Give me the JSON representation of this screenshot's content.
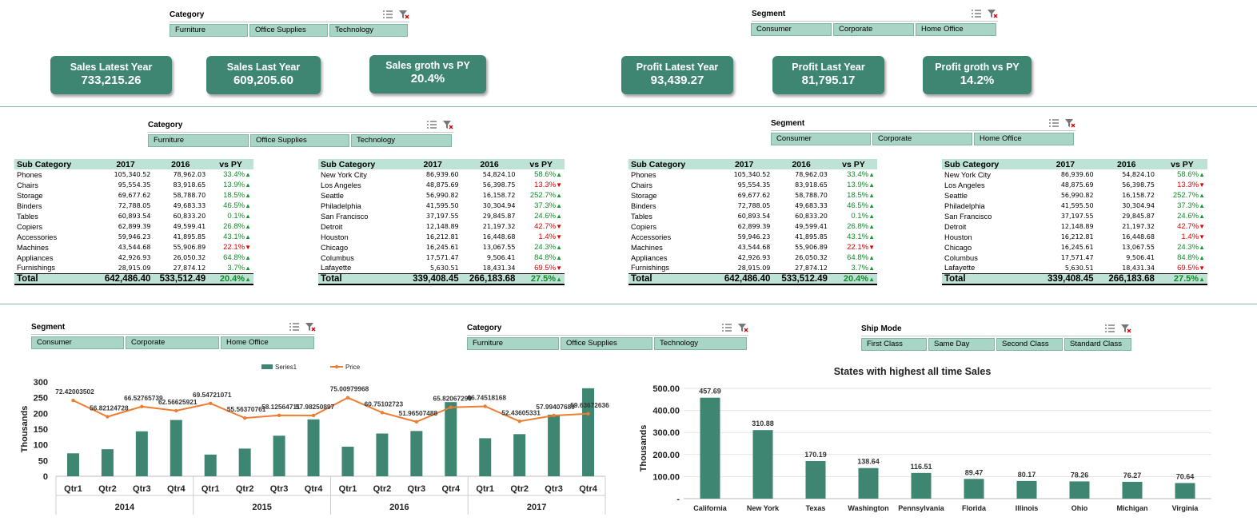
{
  "slicers": {
    "category_top": {
      "title": "Category",
      "items": [
        "Furniture",
        "Office Supplies",
        "Technology"
      ]
    },
    "segment_top": {
      "title": "Segment",
      "items": [
        "Consumer",
        "Corporate",
        "Home Office"
      ]
    },
    "category_mid": {
      "title": "Category",
      "items": [
        "Furniture",
        "Office Supplies",
        "Technology"
      ]
    },
    "segment_mid": {
      "title": "Segment",
      "items": [
        "Consumer",
        "Corporate",
        "Home Office"
      ]
    },
    "segment_bottom": {
      "title": "Segment",
      "items": [
        "Consumer",
        "Corporate",
        "Home Office"
      ]
    },
    "category_bottom": {
      "title": "Category",
      "items": [
        "Furniture",
        "Office Supplies",
        "Technology"
      ]
    },
    "shipmode": {
      "title": "Ship Mode",
      "items": [
        "First Class",
        "Same Day",
        "Second Class",
        "Standard Class"
      ]
    }
  },
  "kpis": [
    {
      "label": "Sales Latest Year",
      "value": "733,215.26"
    },
    {
      "label": "Sales Last Year",
      "value": "609,205.60"
    },
    {
      "label": "Sales groth vs PY",
      "value": "20.4%"
    },
    {
      "label": "Profit Latest Year",
      "value": "93,439.27"
    },
    {
      "label": "Profit Last Year",
      "value": "81,795.17"
    },
    {
      "label": "Profit groth vs PY",
      "value": "14.2%"
    }
  ],
  "colors": {
    "accent": "#3e8671",
    "slicer": "#a9d5c7",
    "header": "#bfe2d6",
    "positive": "#118a2a",
    "negative": "#e00000",
    "line": "#ed7d31"
  },
  "tables": {
    "subcategory": {
      "headers": [
        "Sub Category",
        "2017",
        "2016",
        "vs PY"
      ],
      "rows": [
        [
          "Phones",
          "105,340.52",
          "78,962.03",
          "33.4%",
          "up"
        ],
        [
          "Chairs",
          "95,554.35",
          "83,918.65",
          "13.9%",
          "up"
        ],
        [
          "Storage",
          "69,677.62",
          "58,788.70",
          "18.5%",
          "up"
        ],
        [
          "Binders",
          "72,788.05",
          "49,683.33",
          "46.5%",
          "up"
        ],
        [
          "Tables",
          "60,893.54",
          "60,833.20",
          "0.1%",
          "up"
        ],
        [
          "Copiers",
          "62,899.39",
          "49,599.41",
          "26.8%",
          "up"
        ],
        [
          "Accessories",
          "59,946.23",
          "41,895.85",
          "43.1%",
          "up"
        ],
        [
          "Machines",
          "43,544.68",
          "55,906.89",
          "22.1%",
          "down"
        ],
        [
          "Appliances",
          "42,926.93",
          "26,050.32",
          "64.8%",
          "up"
        ],
        [
          "Furnishings",
          "28,915.09",
          "27,874.12",
          "3.7%",
          "up"
        ]
      ],
      "total": [
        "Total",
        "642,486.40",
        "533,512.49",
        "20.4%",
        "up"
      ]
    },
    "city": {
      "headers": [
        "Sub Category",
        "2017",
        "2016",
        "vs PY"
      ],
      "rows": [
        [
          "New York City",
          "86,939.60",
          "54,824.10",
          "58.6%",
          "up"
        ],
        [
          "Los Angeles",
          "48,875.69",
          "56,398.75",
          "13.3%",
          "down"
        ],
        [
          "Seattle",
          "56,990.82",
          "16,158.72",
          "252.7%",
          "up"
        ],
        [
          "Philadelphia",
          "41,595.50",
          "30,304.94",
          "37.3%",
          "up"
        ],
        [
          "San Francisco",
          "37,197.55",
          "29,845.87",
          "24.6%",
          "up"
        ],
        [
          "Detroit",
          "12,148.89",
          "21,197.32",
          "42.7%",
          "down"
        ],
        [
          "Houston",
          "16,212.81",
          "16,448.68",
          "1.4%",
          "down"
        ],
        [
          "Chicago",
          "16,245.61",
          "13,067.55",
          "24.3%",
          "up"
        ],
        [
          "Columbus",
          "17,571.47",
          "9,506.41",
          "84.8%",
          "up"
        ],
        [
          "Lafayette",
          "5,630.51",
          "18,431.34",
          "69.5%",
          "down"
        ]
      ],
      "total": [
        "Total",
        "339,408.45",
        "266,183.68",
        "27.5%",
        "up"
      ]
    }
  },
  "chart_data": [
    {
      "type": "bar",
      "title": "",
      "ylabel": "Thousands",
      "ylim": [
        0,
        300
      ],
      "yticks": [
        "0",
        "50",
        "100",
        "150",
        "200",
        "250",
        "300"
      ],
      "categories": [
        "Qtr1",
        "Qtr2",
        "Qtr3",
        "Qtr4",
        "Qtr1",
        "Qtr2",
        "Qtr3",
        "Qtr4",
        "Qtr1",
        "Qtr2",
        "Qtr3",
        "Qtr4",
        "Qtr1",
        "Qtr2",
        "Qtr3",
        "Qtr4"
      ],
      "groups": [
        "2014",
        "2015",
        "2016",
        "2017"
      ],
      "legend": [
        "Series1",
        "Price"
      ],
      "series": [
        {
          "name": "Series1",
          "type": "bar",
          "values": [
            73,
            86,
            143,
            179,
            69,
            88,
            129,
            181,
            94,
            136,
            144,
            236,
            121,
            134,
            196,
            280
          ]
        },
        {
          "name": "Price",
          "type": "line",
          "values": [
            72.42003502,
            56.82124728,
            66.52765739,
            62.56625921,
            69.54721071,
            55.56370761,
            58.12564711,
            57.98250897,
            75.00979968,
            60.75102723,
            51.96507488,
            65.82067299,
            66.74518168,
            52.43605331,
            57.99407689,
            59.63672636
          ],
          "labels": [
            "72.42003502",
            "56.82124728",
            "66.52765739",
            "62.56625921",
            "69.54721071",
            "55.56370761",
            "58.12564711",
            "57.98250897",
            "75.00979968",
            "60.75102723",
            "51.96507488",
            "65.82067299",
            "66.74518168",
            "52.43605331",
            "57.99407689",
            "59.63672636"
          ]
        }
      ]
    },
    {
      "type": "bar",
      "title": "States with highest all time Sales",
      "ylabel": "Thousands",
      "ylim": [
        0,
        500
      ],
      "yticks": [
        "-",
        "100.00",
        "200.00",
        "300.00",
        "400.00",
        "500.00"
      ],
      "categories": [
        "California",
        "New York",
        "Texas",
        "Washington",
        "Pennsylvania",
        "Florida",
        "Illinois",
        "Ohio",
        "Michigan",
        "Virginia"
      ],
      "values": [
        457.69,
        310.88,
        170.19,
        138.64,
        116.51,
        89.47,
        80.17,
        78.26,
        76.27,
        70.64
      ],
      "labels": [
        "457.69",
        "310.88",
        "170.19",
        "138.64",
        "116.51",
        "89.47",
        "80.17",
        "78.26",
        "76.27",
        "70.64"
      ]
    }
  ]
}
